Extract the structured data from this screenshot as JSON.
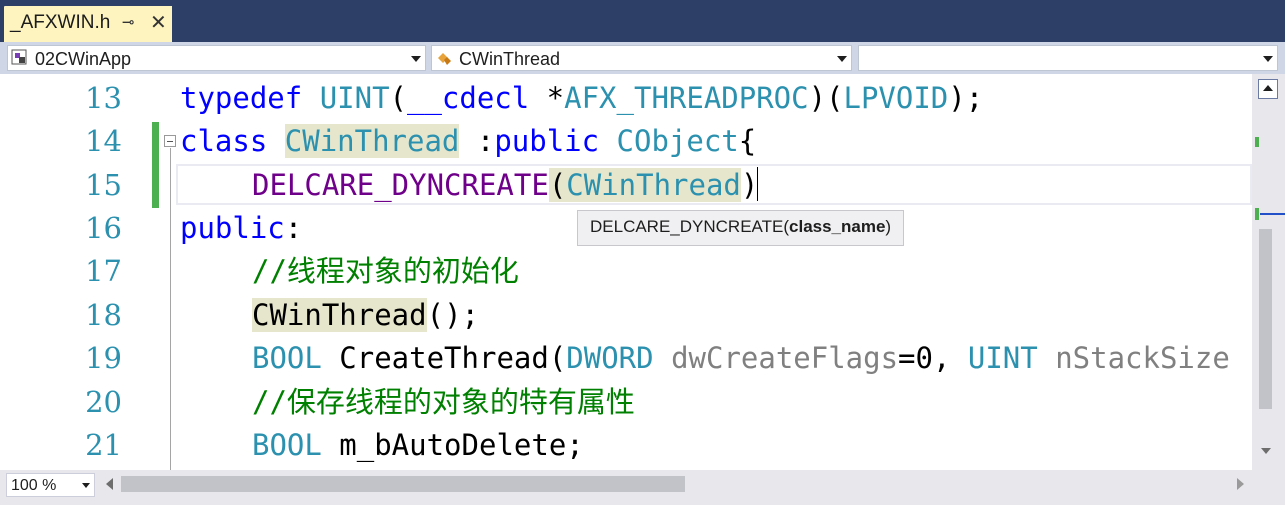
{
  "tab": {
    "title": "_AFXWIN.h",
    "pin_glyph": "⊸",
    "close_glyph": "✕"
  },
  "navigation": {
    "project": {
      "value": "02CWinApp",
      "icon": "project-icon"
    },
    "class": {
      "value": "CWinThread",
      "icon": "class-icon"
    },
    "member": {
      "value": ""
    }
  },
  "editor": {
    "line_numbers": [
      "13",
      "14",
      "15",
      "16",
      "17",
      "18",
      "19",
      "20",
      "21"
    ],
    "lines": {
      "l13": {
        "kw": "typedef",
        "t1": "UINT",
        "p1": "(",
        "kw2": "__cdecl",
        "p2": " *",
        "t2": "AFX_THREADPROC",
        "p3": ")(",
        "t3": "LPVOID",
        "p4": ");"
      },
      "l14": {
        "kw": "class",
        "t1": "CWinThread",
        "p1": " :",
        "kw2": "public",
        "t2": "CObject",
        "p2": "{"
      },
      "l15": {
        "mac": "DELCARE_DYNCREATE",
        "p1": "(",
        "t1": "CWinThread",
        "p2": ")"
      },
      "l16": {
        "kw": "public",
        "p1": ":"
      },
      "l17": {
        "cm": "//线程对象的初始化"
      },
      "l18": {
        "t1": "CWinThread",
        "p1": "();"
      },
      "l19": {
        "t1": "BOOL",
        "p1": " CreateThread(",
        "t2": "DWORD",
        "prm1": "dwCreateFlags",
        "p2": "=0, ",
        "t3": "UINT",
        "prm2": "nStackSize"
      },
      "l20": {
        "cm": "//保存线程的对象的特有属性"
      },
      "l21": {
        "t1": "BOOL",
        "p1": " m_bAutoDelete;"
      }
    },
    "tooltip": {
      "prefix": "DELCARE_DYNCREATE(",
      "param": "class_name",
      "suffix": ")"
    }
  },
  "statusbar": {
    "zoom": "100 %"
  },
  "colors": {
    "tab_bg": "#fdf4bf",
    "chrome": "#2d3f66",
    "keyword": "#0000ff",
    "type": "#2b91af",
    "macro": "#6f008a",
    "comment": "#008000"
  }
}
